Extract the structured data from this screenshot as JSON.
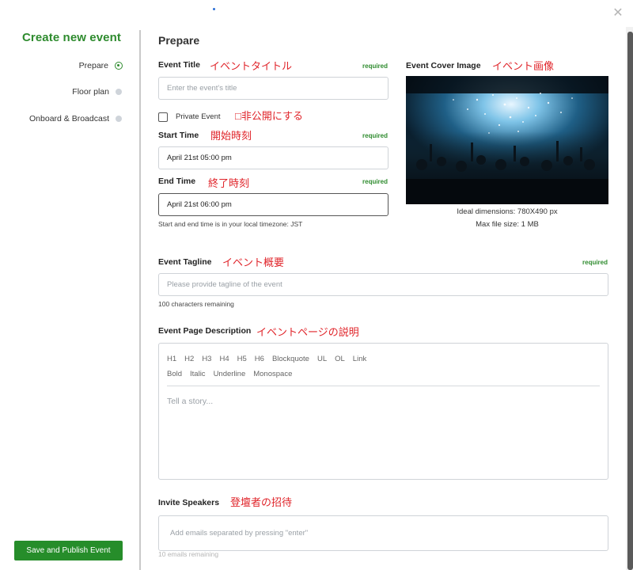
{
  "window": {
    "close_icon": "close-icon"
  },
  "sidebar": {
    "title": "Create new event",
    "steps": [
      {
        "label": "Prepare",
        "active": true
      },
      {
        "label": "Floor plan",
        "active": false
      },
      {
        "label": "Onboard & Broadcast",
        "active": false
      }
    ],
    "publish_button": "Save and Publish Event"
  },
  "main": {
    "section_title": "Prepare",
    "event_title": {
      "label": "Event Title",
      "note": "イベントタイトル",
      "required": "required",
      "placeholder": "Enter the event's title"
    },
    "private_event": {
      "label": "Private Event",
      "note": "□非公開にする",
      "checked": false
    },
    "start_time": {
      "label": "Start Time",
      "note": "開始時刻",
      "required": "required",
      "value": "April 21st 05:00 pm"
    },
    "end_time": {
      "label": "End Time",
      "note": "終了時刻",
      "required": "required",
      "value": "April 21st 06:00 pm"
    },
    "timezone_hint": "Start and end time is in your local timezone: JST",
    "cover_image": {
      "label": "Event Cover Image",
      "note": "イベント画像",
      "dimensions": "Ideal dimensions: 780X490 px",
      "max_size": "Max file size: 1 MB"
    },
    "tagline": {
      "label": "Event Tagline",
      "note": "イベント概要",
      "required": "required",
      "placeholder": "Please provide tagline of the event",
      "remaining": "100 characters remaining"
    },
    "description": {
      "label": "Event Page Description",
      "note": "イベントページの説明",
      "toolbar_row1": [
        "H1",
        "H2",
        "H3",
        "H4",
        "H5",
        "H6",
        "Blockquote",
        "UL",
        "OL",
        "Link"
      ],
      "toolbar_row2": [
        "Bold",
        "Italic",
        "Underline",
        "Monospace"
      ],
      "placeholder": "Tell a story..."
    },
    "speakers": {
      "label": "Invite Speakers",
      "note": "登壇者の招待",
      "placeholder": "Add emails separated by pressing \"enter\"",
      "remaining": "10 emails remaining"
    }
  },
  "colors": {
    "brand_green": "#2e8b2e",
    "button_green": "#268d2a",
    "annotation_red": "#e0242a"
  }
}
